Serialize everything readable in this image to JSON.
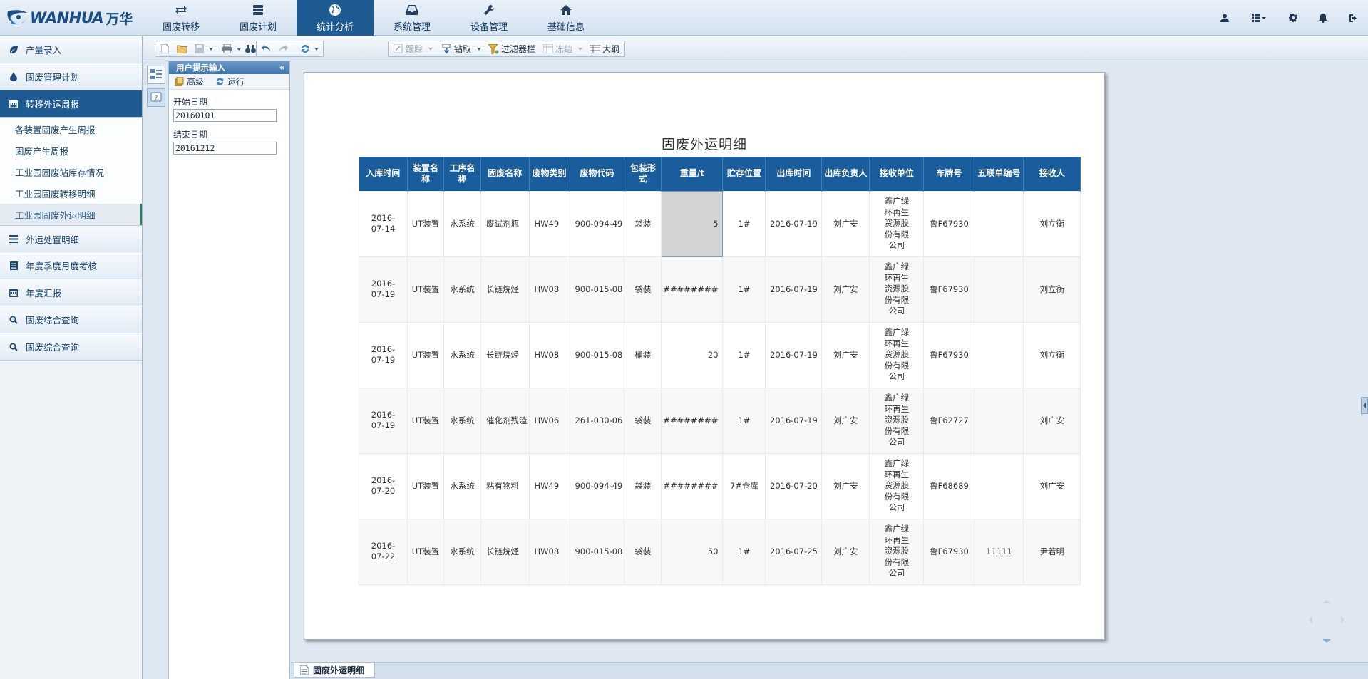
{
  "brand": {
    "name_en": "WANHUA",
    "name_cn": "万华"
  },
  "nav": [
    {
      "label": "固废转移",
      "icon": "swap-icon"
    },
    {
      "label": "固废计划",
      "icon": "stack-icon"
    },
    {
      "label": "统计分析",
      "icon": "globe-icon",
      "active": true
    },
    {
      "label": "系统管理",
      "icon": "inbox-icon"
    },
    {
      "label": "设备管理",
      "icon": "wrench-icon"
    },
    {
      "label": "基础信息",
      "icon": "home-icon"
    }
  ],
  "sidebar": {
    "items": [
      {
        "label": "产量录入",
        "icon": "leaf-icon"
      },
      {
        "label": "固废管理计划",
        "icon": "drop-icon"
      },
      {
        "label": "转移外运周报",
        "icon": "calendar-icon",
        "active": true
      }
    ],
    "subitems": [
      {
        "label": "各装置固废产生周报"
      },
      {
        "label": "固废产生周报"
      },
      {
        "label": "工业园固废站库存情况"
      },
      {
        "label": "工业园固废转移明细"
      },
      {
        "label": "工业园固废外运明细",
        "selected": true
      }
    ],
    "items_after": [
      {
        "label": "外运处置明细",
        "icon": "list-icon"
      },
      {
        "label": "年度季度月度考核",
        "icon": "doc-icon"
      },
      {
        "label": "年度汇报",
        "icon": "calendar-icon"
      },
      {
        "label": "固废综合查询",
        "icon": "search-icon"
      },
      {
        "label": "固废综合查询",
        "icon": "search-icon"
      }
    ]
  },
  "toolbar": {
    "trace": "跟踪",
    "drill": "钻取",
    "filter": "过滤器栏",
    "freeze": "冻结",
    "outline": "大纲"
  },
  "prompt": {
    "title": "用户提示输入",
    "advanced": "高级",
    "run": "运行",
    "start_label": "开始日期",
    "start_value": "20160101",
    "end_label": "结束日期",
    "end_value": "20161212"
  },
  "report": {
    "title": "固废外运明细",
    "headers": [
      "入库时间",
      "装置名称",
      "工序名称",
      "固废名称",
      "废物类别",
      "废物代码",
      "包装形式",
      "重量/t",
      "贮存位置",
      "出库时间",
      "出库负责人",
      "接收单位",
      "车牌号",
      "五联单编号",
      "接收人"
    ],
    "rows": [
      [
        "2016-07-14",
        "UT装置",
        "水系统",
        "废试剂瓶",
        "HW49",
        "900-094-49",
        "袋装",
        "5",
        "1#",
        "2016-07-19",
        "刘广安",
        "鑫广绿环再生资源股份有限公司",
        "鲁F67930",
        "",
        "刘立衡"
      ],
      [
        "2016-07-19",
        "UT装置",
        "水系统",
        "长链烷烃",
        "HW08",
        "900-015-08",
        "袋装",
        "########",
        "1#",
        "2016-07-19",
        "刘广安",
        "鑫广绿环再生资源股份有限公司",
        "鲁F67930",
        "",
        "刘立衡"
      ],
      [
        "2016-07-19",
        "UT装置",
        "水系统",
        "长链烷烃",
        "HW08",
        "900-015-08",
        "桶装",
        "20",
        "1#",
        "2016-07-19",
        "刘广安",
        "鑫广绿环再生资源股份有限公司",
        "鲁F67930",
        "",
        "刘立衡"
      ],
      [
        "2016-07-19",
        "UT装置",
        "水系统",
        "催化剂残渣",
        "HW06",
        "261-030-06",
        "袋装",
        "########",
        "1#",
        "2016-07-19",
        "刘广安",
        "鑫广绿环再生资源股份有限公司",
        "鲁F62727",
        "",
        "刘广安"
      ],
      [
        "2016-07-20",
        "UT装置",
        "水系统",
        "粘有物料",
        "HW49",
        "900-094-49",
        "袋装",
        "########",
        "7#仓库",
        "2016-07-20",
        "刘广安",
        "鑫广绿环再生资源股份有限公司",
        "鲁F68689",
        "",
        "刘广安"
      ],
      [
        "2016-07-22",
        "UT装置",
        "水系统",
        "长链烷烃",
        "HW08",
        "900-015-08",
        "袋装",
        "50",
        "1#",
        "2016-07-25",
        "刘广安",
        "鑫广绿环再生资源股份有限公司",
        "鲁F67930",
        "11111",
        "尹若明"
      ]
    ]
  },
  "bottom_tab": {
    "label": "固废外运明细"
  },
  "colors": {
    "nav_active": "#1e5b93",
    "header_bg": "#1a5d9c",
    "selected_cell": "#d4d4d4"
  }
}
